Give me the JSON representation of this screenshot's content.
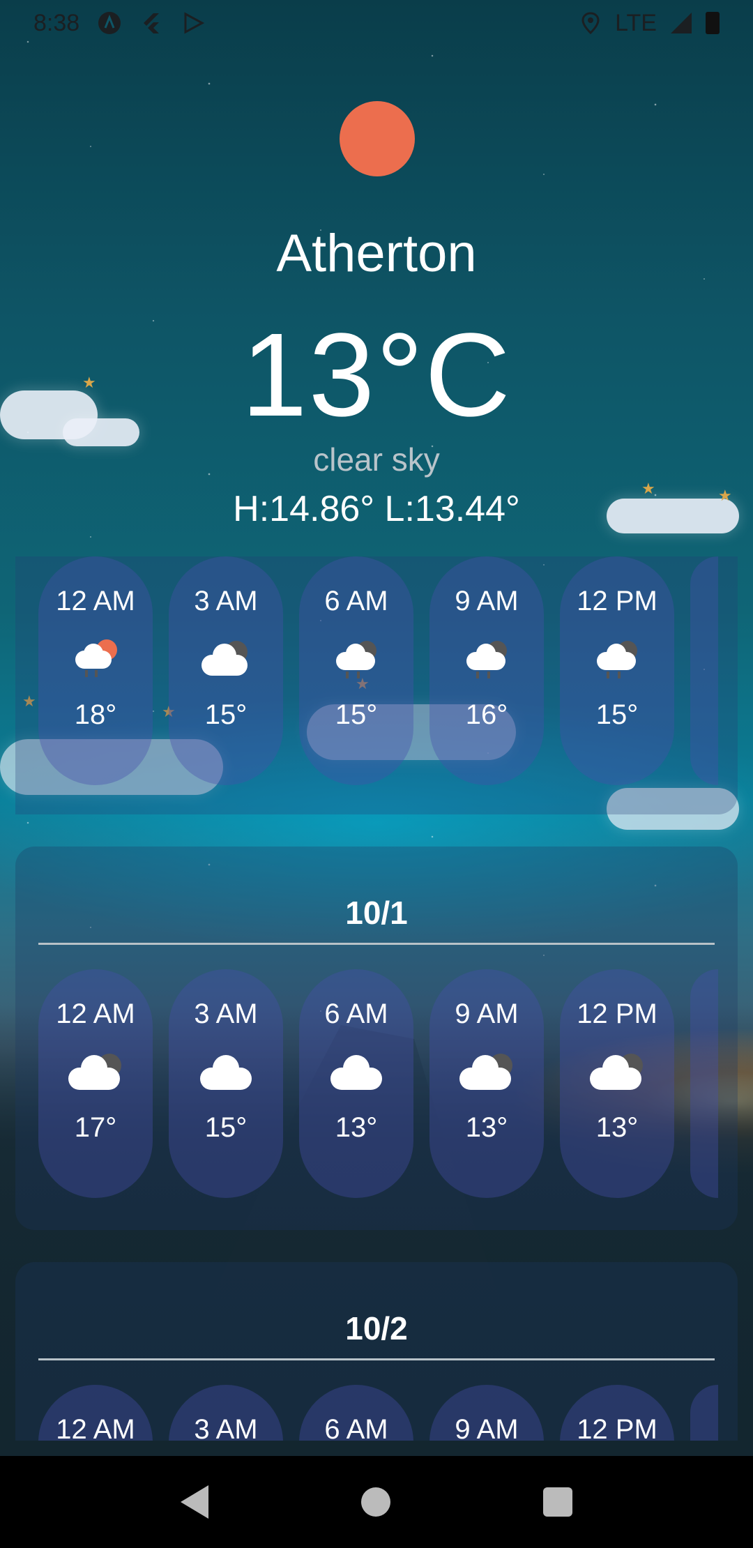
{
  "status_bar": {
    "time": "8:38",
    "network": "LTE",
    "icons": [
      "app-icon",
      "flutter-icon",
      "play-icon",
      "location-icon",
      "signal-icon",
      "battery-icon"
    ]
  },
  "current": {
    "city": "Atherton",
    "temperature": "13°C",
    "description": "clear sky",
    "high_low": "H:14.86° L:13.44°",
    "icon": "sun-icon",
    "sun_color": "#ec6e4e"
  },
  "hourly_today": [
    {
      "time": "12 AM",
      "icon": "partly-cloudy-rain-icon",
      "temp": "18°"
    },
    {
      "time": "3 AM",
      "icon": "cloudy-icon",
      "temp": "15°"
    },
    {
      "time": "6 AM",
      "icon": "rain-cloud-icon",
      "temp": "15°"
    },
    {
      "time": "9 AM",
      "icon": "rain-cloud-icon",
      "temp": "16°"
    },
    {
      "time": "12 PM",
      "icon": "rain-cloud-icon",
      "temp": "15°"
    }
  ],
  "days": [
    {
      "date": "10/1",
      "hours": [
        {
          "time": "12 AM",
          "icon": "cloudy-icon",
          "temp": "17°"
        },
        {
          "time": "3 AM",
          "icon": "cloud-icon",
          "temp": "15°"
        },
        {
          "time": "6 AM",
          "icon": "cloud-icon",
          "temp": "13°"
        },
        {
          "time": "9 AM",
          "icon": "cloudy-icon",
          "temp": "13°"
        },
        {
          "time": "12 PM",
          "icon": "cloudy-icon",
          "temp": "13°"
        }
      ]
    },
    {
      "date": "10/2",
      "hours": [
        {
          "time": "12 AM"
        },
        {
          "time": "3 AM"
        },
        {
          "time": "6 AM"
        },
        {
          "time": "9 AM"
        },
        {
          "time": "12 PM"
        }
      ]
    }
  ],
  "nav": {
    "back": "back-icon",
    "home": "home-icon",
    "recents": "recents-icon"
  }
}
